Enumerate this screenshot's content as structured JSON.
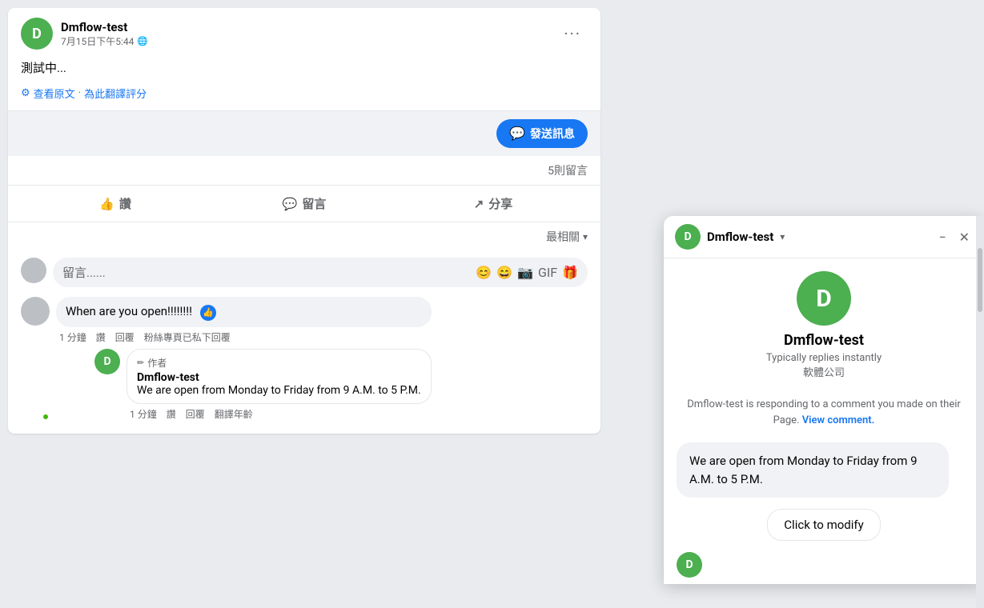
{
  "post": {
    "author": "Dmflow-test",
    "avatar_letter": "D",
    "time": "7月15日下午5:44",
    "globe": "🌐",
    "more_btn": "···",
    "content": "測試中...",
    "gear_symbol": "⚙",
    "translate_link": "查看原文",
    "rate_link": "為此翻譯評分",
    "send_message_label": "發送訊息",
    "comment_count": "5則留言",
    "like_label": "讚",
    "comment_label": "留言",
    "share_label": "分享",
    "sort_label": "最相關",
    "comment_placeholder": "留言......",
    "comment_icon1": "😊",
    "comment_icon2": "😄",
    "comment_icon3": "📷",
    "comment_icon4": "GIF",
    "comment_icon5": "🎁"
  },
  "comments": [
    {
      "author": "",
      "text": "When are you open!!!!!!!!",
      "has_like": true,
      "time": "1 分鐘",
      "like_action": "讚",
      "reply_action": "回覆",
      "private_reply": "粉絲專頁已私下回覆",
      "replies": [
        {
          "pencil": "✏",
          "author_label": "作者",
          "author": "Dmflow-test",
          "text": "We are open from Monday to Friday from 9 A.M. to 5 P.M.",
          "time": "1 分鐘",
          "like_action": "讚",
          "reply_action": "回覆",
          "translate_action": "翻譯年齡"
        }
      ]
    }
  ],
  "messenger": {
    "page_name": "Dmflow-test",
    "avatar_letter": "D",
    "chevron": "▾",
    "minimize_icon": "−",
    "close_icon": "✕",
    "avatar_large_letter": "D",
    "display_name": "Dmflow-test",
    "replies_instantly": "Typically replies instantly",
    "company_type": "軟體公司",
    "responding_notice": "Dmflow-test is responding to a comment you made on their Page.",
    "view_comment_link": "View comment.",
    "message_text": "We are open from Monday to Friday from 9 A.M. to 5 P.M.",
    "click_to_modify": "Click to modify",
    "bottom_avatar_letter": "D"
  }
}
